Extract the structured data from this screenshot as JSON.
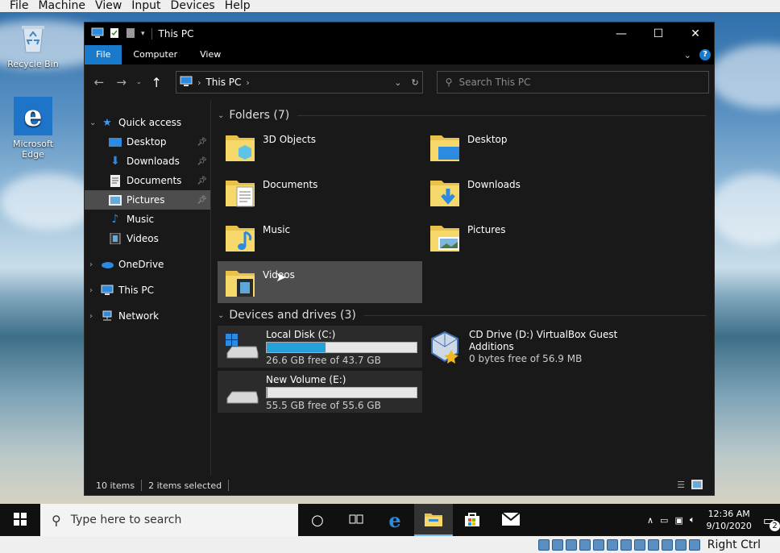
{
  "host_menu": [
    "File",
    "Machine",
    "View",
    "Input",
    "Devices",
    "Help"
  ],
  "desktop": {
    "icons": [
      {
        "label": "Recycle Bin"
      },
      {
        "label": "Microsoft Edge"
      }
    ]
  },
  "window": {
    "title": "This PC",
    "ribbon_tabs": [
      "File",
      "Computer",
      "View"
    ],
    "address": {
      "crumb": "This PC"
    },
    "search_placeholder": "Search This PC",
    "nav": {
      "quick_access": "Quick access",
      "quick_items": [
        "Desktop",
        "Downloads",
        "Documents",
        "Pictures",
        "Music",
        "Videos"
      ],
      "onedrive": "OneDrive",
      "this_pc": "This PC",
      "network": "Network"
    },
    "folders_header": "Folders (7)",
    "folders": [
      "3D Objects",
      "Desktop",
      "Documents",
      "Downloads",
      "Music",
      "Pictures",
      "Videos"
    ],
    "drives_header": "Devices and drives (3)",
    "drives": [
      {
        "name": "Local Disk (C:)",
        "free": "26.6 GB free of 43.7 GB",
        "used_fraction": 0.39
      },
      {
        "name": "CD Drive (D:) VirtualBox Guest Additions",
        "free": "0 bytes free of 56.9 MB"
      },
      {
        "name": "New Volume (E:)",
        "free": "55.5 GB free of 55.6 GB",
        "used_fraction": 0.002
      }
    ],
    "status": {
      "items": "10 items",
      "selected": "2 items selected"
    }
  },
  "taskbar": {
    "search_placeholder": "Type here to search",
    "time": "12:36 AM",
    "date": "9/10/2020",
    "notifications": "2"
  },
  "vbox_status": {
    "host_key": "Right Ctrl"
  },
  "colors": {
    "accent": "#1979ca",
    "window_bg": "#191919",
    "selection": "#4d4d4d",
    "drive_bar": "#26a0da"
  }
}
